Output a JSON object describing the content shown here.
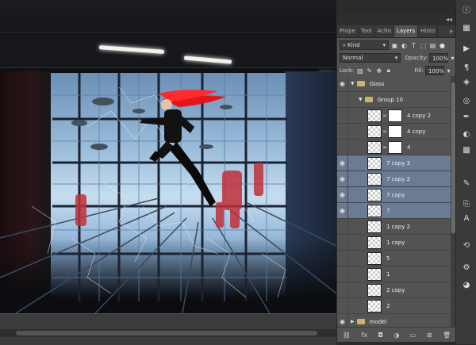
{
  "panel": {
    "tabs": [
      {
        "label": "Prope",
        "active": false
      },
      {
        "label": "Tool",
        "active": false
      },
      {
        "label": "Actio",
        "active": false
      },
      {
        "label": "Layers",
        "active": true
      },
      {
        "label": "Histo",
        "active": false
      }
    ],
    "tab_menu": "»",
    "kind_label": "Kind",
    "blend_mode": "Normal",
    "opacity_label": "Opacity:",
    "opacity_value": "100%",
    "lock_label": "Lock:",
    "fill_label": "Fill:",
    "fill_value": "100%"
  },
  "layers": [
    {
      "name": "Glass",
      "type": "group",
      "visible": true,
      "expanded": true,
      "indent": 0,
      "selected": false
    },
    {
      "name": "Group 10",
      "type": "group",
      "visible": false,
      "expanded": true,
      "indent": 1,
      "selected": false
    },
    {
      "name": "4 copy 2",
      "type": "masked",
      "visible": false,
      "selected": false
    },
    {
      "name": "4 copy",
      "type": "masked",
      "visible": false,
      "selected": false
    },
    {
      "name": "4",
      "type": "masked",
      "visible": false,
      "selected": false
    },
    {
      "name": "7 copy 3",
      "type": "layer",
      "visible": true,
      "selected": true
    },
    {
      "name": "7 copy 2",
      "type": "layer",
      "visible": true,
      "selected": true
    },
    {
      "name": "7 copy",
      "type": "layer",
      "visible": true,
      "selected": true
    },
    {
      "name": "7",
      "type": "layer",
      "visible": true,
      "selected": true
    },
    {
      "name": "1 copy 2",
      "type": "layer",
      "visible": false,
      "selected": false
    },
    {
      "name": "1 copy",
      "type": "layer",
      "visible": false,
      "selected": false
    },
    {
      "name": "5",
      "type": "layer",
      "visible": false,
      "selected": false
    },
    {
      "name": "1",
      "type": "layer",
      "visible": false,
      "selected": false
    },
    {
      "name": "2 copy",
      "type": "layer",
      "visible": false,
      "selected": false
    },
    {
      "name": "2",
      "type": "layer",
      "visible": false,
      "selected": false
    },
    {
      "name": "model",
      "type": "group",
      "visible": true,
      "expanded": false,
      "indent": 0,
      "selected": false
    }
  ],
  "footer_icons": [
    "link-icon",
    "fx-icon",
    "mask-icon",
    "adjustment-icon",
    "folder-icon",
    "new-layer-icon",
    "trash-icon"
  ],
  "tools": [
    "info-icon",
    "swatches-icon",
    "play-icon",
    "paragraph-icon",
    "layers-icon",
    "channels-icon",
    "paths-icon",
    "adjust-icon",
    "styles-icon",
    "brush-icon",
    "clone-icon",
    "character-icon",
    "history-icon",
    "settings-icon",
    "color-icon"
  ],
  "colors": {
    "selected_layer": "#6b7b94",
    "panel_bg": "#535353",
    "canvas_red": "#c0303a"
  }
}
